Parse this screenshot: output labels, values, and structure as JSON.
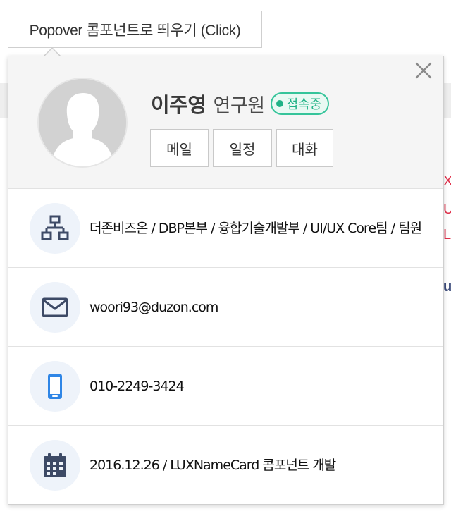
{
  "trigger": {
    "label": "Popover 콤포넌트로 띄우기 (Click)"
  },
  "background": {
    "letters": [
      "X",
      "U",
      "L",
      "u"
    ]
  },
  "profile": {
    "name": "이주영",
    "title": "연구원",
    "status": "접속중",
    "actions": [
      "메일",
      "일정",
      "대화"
    ]
  },
  "details": {
    "org": "더존비즈온 / DBP본부 / 융합기술개발부 / UI/UX Core팀 / 팀원",
    "email": "woori93@duzon.com",
    "phone": "010-2249-3424",
    "note": "2016.12.26 / LUXNameCard 콤포넌트 개발"
  },
  "colors": {
    "status_green": "#20b286",
    "icon_dark": "#3d4a66",
    "icon_blue": "#2f86e6",
    "accent_red": "#e0314b"
  },
  "icons": [
    "close-icon",
    "avatar-silhouette",
    "org-chart-icon",
    "mail-icon",
    "mobile-phone-icon",
    "calendar-icon"
  ]
}
